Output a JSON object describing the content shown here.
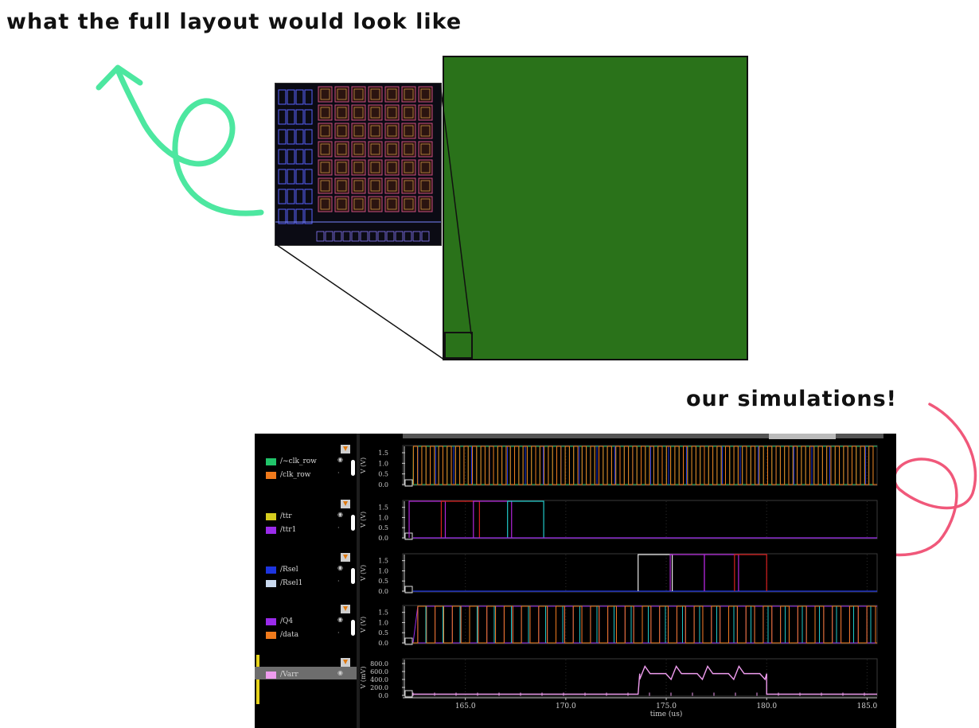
{
  "annotations": {
    "layout_note": "what the full layout would look like",
    "sim_note": "our simulations!"
  },
  "colors": {
    "green_arrow": "#4de7a0",
    "pink_arrow": "#f0587a",
    "layout_green": "#2a721a"
  },
  "chart_data": {
    "type": "line",
    "title": "",
    "xlabel": "time (us)",
    "xlim": [
      162.0,
      185.5
    ],
    "xticks": [
      165.0,
      170.0,
      175.0,
      180.0,
      185.0
    ],
    "xtick_labels": [
      "165.0",
      "170.0",
      "175.0",
      "180.0",
      "185.0"
    ],
    "strips": [
      {
        "ylabel": "V (V)",
        "yticks": [
          "1.5",
          "1.0",
          "0.5",
          "0.0"
        ],
        "ylim": [
          0,
          1.8
        ],
        "series": [
          {
            "name": "/~clk_row",
            "color": "#21c46a",
            "kind": "clock"
          },
          {
            "name": "/clk_row",
            "color": "#ef7a1c",
            "kind": "clock"
          }
        ]
      },
      {
        "ylabel": "V (V)",
        "yticks": [
          "1.5",
          "1.0",
          "0.5",
          "0.0"
        ],
        "ylim": [
          0,
          1.8
        ],
        "series": [
          {
            "name": "/ttr",
            "color": "#d6cd1f",
            "kind": "pulses",
            "pulses": [
              [
                162.2,
                164.0
              ],
              [
                163.8,
                165.7
              ],
              [
                165.4,
                167.3
              ],
              [
                167.1,
                168.9
              ]
            ],
            "pulse_colors": [
              "#b026d8",
              "#d81f1f",
              "#b026d8",
              "#20c8c8"
            ]
          },
          {
            "name": "/ttr1",
            "color": "#9a2bea",
            "kind": "low"
          }
        ]
      },
      {
        "ylabel": "V (V)",
        "yticks": [
          "1.5",
          "1.0",
          "0.5",
          "0.0"
        ],
        "ylim": [
          0,
          1.8
        ],
        "series": [
          {
            "name": "/Rsel",
            "color": "#1d35e0",
            "kind": "low"
          },
          {
            "name": "/Rsel1",
            "color": "#c9d9ef",
            "kind": "pulses",
            "pulses": [
              [
                173.6,
                175.3
              ],
              [
                175.2,
                176.9
              ],
              [
                176.9,
                178.6
              ],
              [
                178.4,
                180.0
              ]
            ],
            "pulse_colors": [
              "#e8e8e8",
              "#b026d8",
              "#b026d8",
              "#d81f1f"
            ]
          }
        ]
      },
      {
        "ylabel": "V (V)",
        "yticks": [
          "1.5",
          "1.0",
          "0.5",
          "0.0"
        ],
        "ylim": [
          0,
          1.8
        ],
        "series": [
          {
            "name": "/Q4",
            "color": "#9a2bea",
            "kind": "fastclock"
          },
          {
            "name": "/data",
            "color": "#ef7a1c",
            "kind": "fastclock"
          }
        ]
      },
      {
        "ylabel": "V (mV)",
        "yticks": [
          "800.0",
          "600.0",
          "400.0",
          "200.0",
          "0.0"
        ],
        "ylim": [
          0,
          900
        ],
        "series": [
          {
            "name": "/Varr",
            "color": "#ee9cee",
            "kind": "analog",
            "high_start": 173.6,
            "high_end": 180.0,
            "high_level": 730
          }
        ]
      }
    ]
  }
}
